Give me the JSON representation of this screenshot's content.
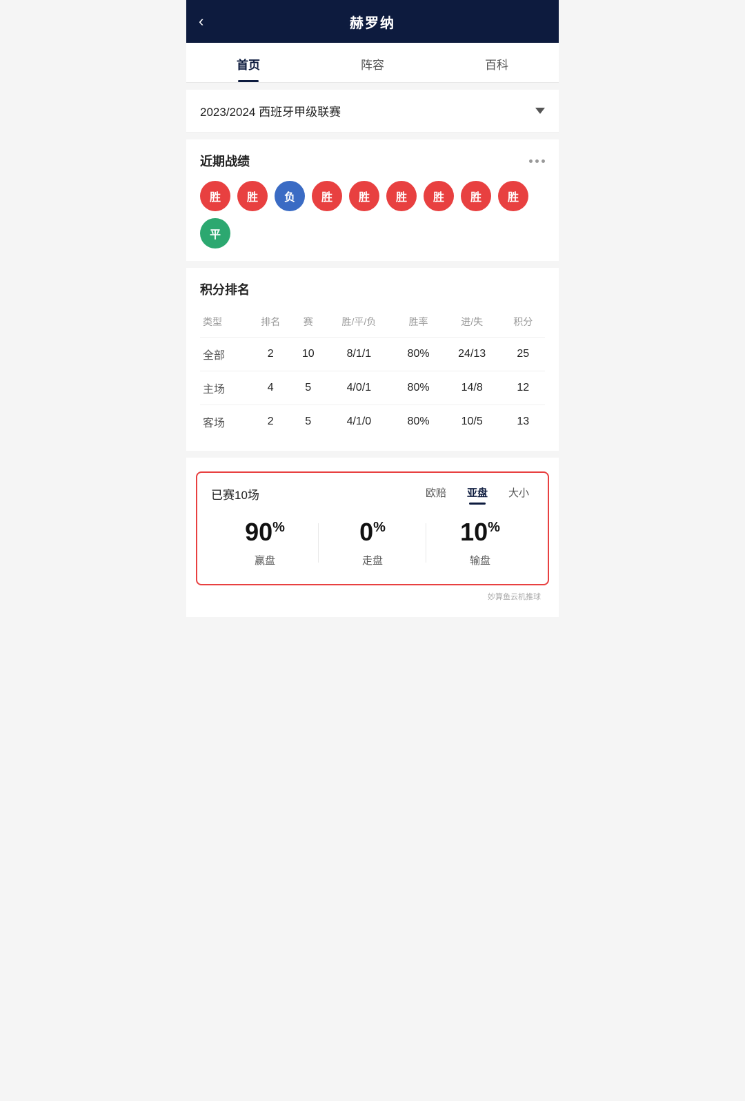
{
  "header": {
    "title": "赫罗纳",
    "back_label": "‹"
  },
  "tabs": [
    {
      "id": "home",
      "label": "首页",
      "active": true
    },
    {
      "id": "lineup",
      "label": "阵容",
      "active": false
    },
    {
      "id": "wiki",
      "label": "百科",
      "active": false
    }
  ],
  "season": {
    "text": "2023/2024 西班牙甲级联赛"
  },
  "recent_results": {
    "title": "近期战绩",
    "results": [
      {
        "label": "胜",
        "type": "win"
      },
      {
        "label": "胜",
        "type": "win"
      },
      {
        "label": "负",
        "type": "loss"
      },
      {
        "label": "胜",
        "type": "win"
      },
      {
        "label": "胜",
        "type": "win"
      },
      {
        "label": "胜",
        "type": "win"
      },
      {
        "label": "胜",
        "type": "win"
      },
      {
        "label": "胜",
        "type": "win"
      },
      {
        "label": "胜",
        "type": "win"
      },
      {
        "label": "平",
        "type": "draw"
      }
    ]
  },
  "standings": {
    "title": "积分排名",
    "headers": [
      "类型",
      "排名",
      "赛",
      "胜/平/负",
      "胜率",
      "进/失",
      "积分"
    ],
    "rows": [
      {
        "type": "全部",
        "rank": "2",
        "matches": "10",
        "wdl": "8/1/1",
        "rate": "80%",
        "gf_ga": "24/13",
        "points": "25"
      },
      {
        "type": "主场",
        "rank": "4",
        "matches": "5",
        "wdl": "4/0/1",
        "rate": "80%",
        "gf_ga": "14/8",
        "points": "12"
      },
      {
        "type": "客场",
        "rank": "2",
        "matches": "5",
        "wdl": "4/1/0",
        "rate": "80%",
        "gf_ga": "10/5",
        "points": "13"
      }
    ]
  },
  "handicap": {
    "title": "已赛10场",
    "columns": [
      {
        "label": "欧赔",
        "active": false
      },
      {
        "label": "亚盘",
        "active": true
      },
      {
        "label": "大小",
        "active": false
      }
    ],
    "stats": [
      {
        "percent": "90",
        "label": "赢盘"
      },
      {
        "percent": "0",
        "label": "走盘"
      },
      {
        "percent": "10",
        "label": "输盘"
      }
    ]
  },
  "watermark": "妙算鱼云机推球"
}
